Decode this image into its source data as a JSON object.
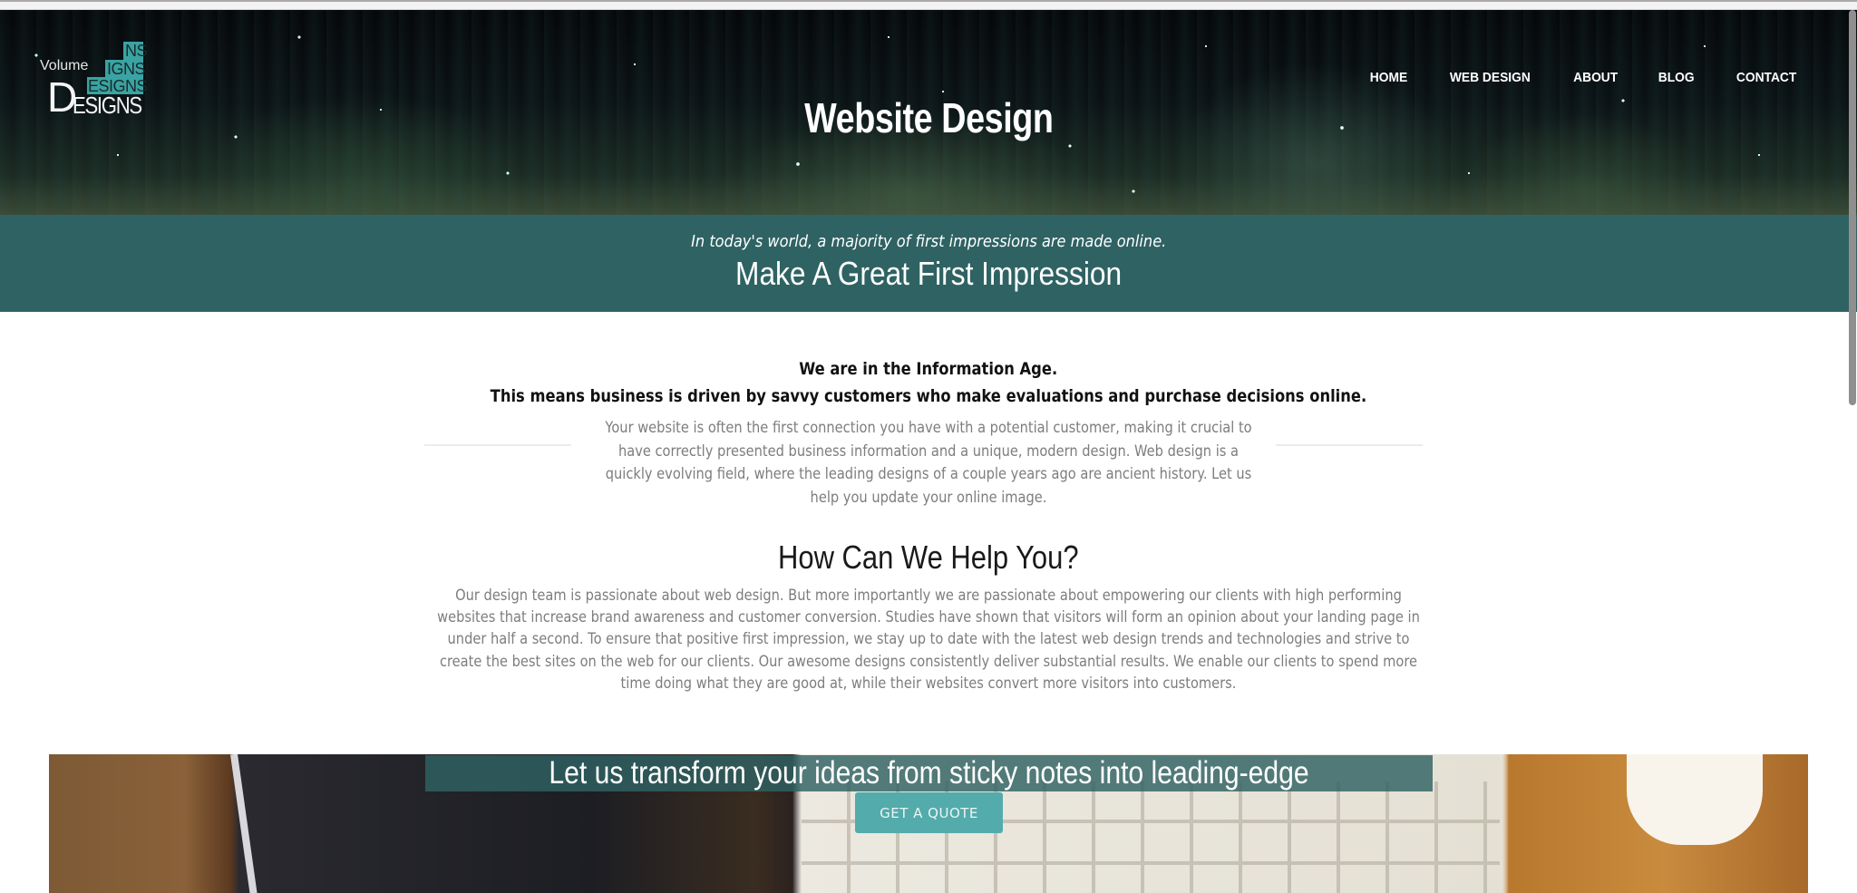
{
  "logo": {
    "word_top": "Volume",
    "rows": [
      "NS",
      "IGNS",
      "ESIGNS"
    ],
    "big_letter": "D",
    "bottom_word": "ESIGNS",
    "brand_color": "#3aa3a3"
  },
  "nav": {
    "items": [
      {
        "label": "HOME"
      },
      {
        "label": "WEB DESIGN"
      },
      {
        "label": "ABOUT"
      },
      {
        "label": "BLOG"
      },
      {
        "label": "CONTACT"
      }
    ]
  },
  "hero": {
    "title": "Website Design"
  },
  "band": {
    "intro": "In today's world, a majority of first impressions are made online.",
    "headline": "Make A Great First Impression",
    "color": "#2f6263"
  },
  "content": {
    "lead_1": "We are in the Information Age.",
    "lead_2": "This means business is driven by savvy customers who make evaluations and purchase decisions online.",
    "paragraph_1": "Your website is often the first connection you have with a potential customer, making it crucial to have correctly presented business information and a unique, modern design. Web design is a quickly evolving field, where the leading designs of a couple years ago are ancient history.  Let us help you update your online image.",
    "help_title": "How Can We Help You?",
    "paragraph_2": "Our design team is passionate about web design. But more importantly we are passionate about empowering our clients with high performing websites that increase brand awareness and customer conversion. Studies have shown that visitors will form an opinion about your landing page in under half a second.  To ensure that positive first impression, we stay up to date with the latest web design trends and technologies and strive to create the best sites on the web for our clients. Our awesome designs consistently deliver substantial results. We enable our clients to spend more time doing what they are good at, while their websites convert more visitors into customers."
  },
  "banner": {
    "tagline": "Let us transform your ideas from sticky notes into leading-edge websites.",
    "cta_label": "GET A QUOTE",
    "cta_color": "#54abab"
  }
}
